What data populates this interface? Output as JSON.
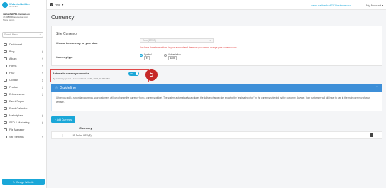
{
  "sidebar": {
    "logo_name": "WebsiteBuilder",
    "logo_sub": "for NB-Ent",
    "user_name": "nathanhall701.invisweb.co",
    "user_email": "nh10859@googlemail.com",
    "user_role": "Store Admin",
    "search_placeholder": "Search Menu...",
    "items": [
      {
        "label": "Dashboard",
        "chevron": false
      },
      {
        "label": "Blog",
        "chevron": true
      },
      {
        "label": "Album",
        "chevron": true
      },
      {
        "label": "Forms",
        "chevron": true
      },
      {
        "label": "FAQ",
        "chevron": true
      },
      {
        "label": "Contact",
        "chevron": true
      },
      {
        "label": "Product",
        "chevron": true
      },
      {
        "label": "E-Commerce",
        "chevron": true
      },
      {
        "label": "Event Popup",
        "chevron": false
      },
      {
        "label": "Event Calendar",
        "chevron": false
      },
      {
        "label": "Marketplace",
        "chevron": true
      },
      {
        "label": "SEO & Marketing",
        "chevron": true
      },
      {
        "label": "File Manager",
        "chevron": false
      },
      {
        "label": "Site Settings",
        "chevron": true
      }
    ],
    "design_button": "Design Website"
  },
  "topbar": {
    "help": "Help",
    "site_url": "www.nathanhall701.invisweb.co",
    "account": "My Account"
  },
  "page": {
    "title": "Currency"
  },
  "site_currency": {
    "title": "Site Currency",
    "choose_label": "Choose the currency for your store",
    "select_value": "Euro (€/EUR)",
    "warning": "You have done transactions in your account and therefore you cannot change your currency now.",
    "type_label": "Currency type",
    "opt_symbol_title": "Symbol",
    "opt_symbol_value": "€",
    "opt_abbr_title": "Abbreviation",
    "opt_abbr_value": "EUR"
  },
  "auto_converter": {
    "title": "Automatic currency converter",
    "toggle_label": "ON",
    "info": "By currencyApi.net - Last updated Jul 30, 2021, 01:57 UTC"
  },
  "annotation": {
    "step": "5"
  },
  "guideline": {
    "title": "Guideline",
    "text": "When you add a secondary currency, your customers will can change the currency from a currency widget. The system automatically calculates the daily exchange rate, showing the \"estimated price\" in the currency selected by the customer. Anyway, Your customers will still have to pay in the main currency of your website."
  },
  "currency_table": {
    "add_button": "+ Add Currency",
    "column_header": "Currency",
    "rows": [
      {
        "currency": "US Dollar USD($)"
      }
    ]
  },
  "colors": {
    "accent": "#1aa7d8",
    "guide_header": "#3d8fd8",
    "warning": "#e23b3b",
    "highlight_border": "#e04848",
    "step_badge": "#c62828"
  }
}
